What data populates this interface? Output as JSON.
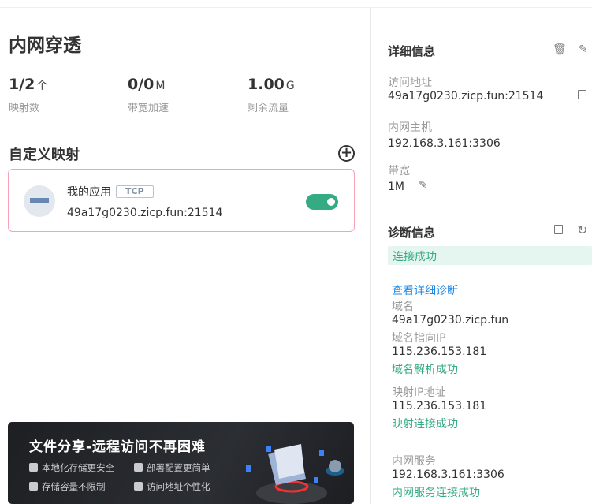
{
  "left": {
    "title": "内网穿透",
    "stats": [
      {
        "value": "1/2",
        "unit": "个",
        "label": "映射数"
      },
      {
        "value": "0/0",
        "unit": "M",
        "label": "带宽加速"
      },
      {
        "value": "1.00",
        "unit": "G",
        "label": "剩余流量"
      }
    ],
    "section_title": "自定义映射",
    "mapping": {
      "name": "我的应用",
      "protocol": "TCP",
      "address": "49a17g0230.zicp.fun:21514",
      "enabled": true
    },
    "banner": {
      "title": "文件分享-远程访问不再困难",
      "features": [
        "本地化存储更安全",
        "部署配置更简单",
        "存储容量不限制",
        "访问地址个性化"
      ]
    }
  },
  "details": {
    "title": "详细信息",
    "access_label": "访问地址",
    "access_value": "49a17g0230.zicp.fun:21514",
    "host_label": "内网主机",
    "host_value": "192.168.3.161:3306",
    "bw_label": "带宽",
    "bw_value": "1M"
  },
  "diag": {
    "title": "诊断信息",
    "status": "连接成功",
    "detail_link": "查看详细诊断",
    "domain_label": "域名",
    "domain_value": "49a17g0230.zicp.fun",
    "domain_ip_label": "域名指向IP",
    "domain_ip_value": "115.236.153.181",
    "domain_ip_status": "域名解析成功",
    "map_ip_label": "映射IP地址",
    "map_ip_value": "115.236.153.181",
    "map_ip_status": "映射连接成功",
    "service_label": "内网服务",
    "service_value": "192.168.3.161:3306",
    "service_status": "内网服务连接成功"
  },
  "colors": {
    "accent": "#34ab82",
    "link": "#1e88e5",
    "card_border": "#f5a3b9"
  }
}
